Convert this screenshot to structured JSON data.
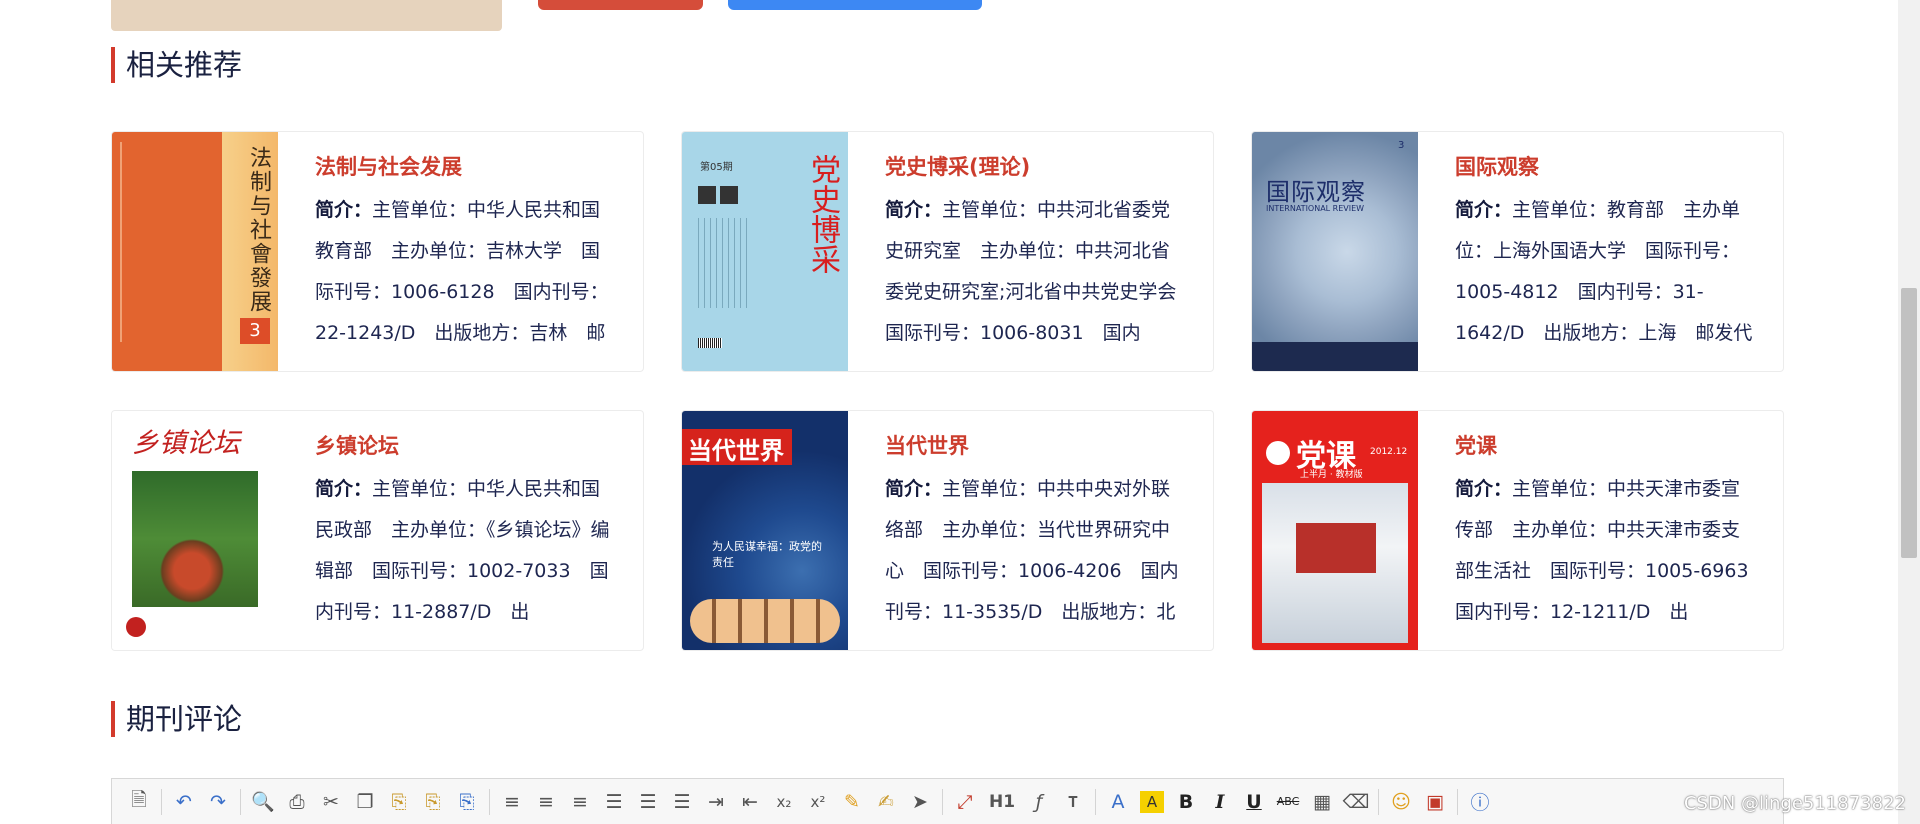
{
  "sections": {
    "related_title": "相关推荐",
    "comments_title": "期刊评论"
  },
  "cards": [
    {
      "title": "法制与社会发展",
      "desc_label": "简介：",
      "desc": "主管单位：中华人民共和国教育部　主办单位：吉林大学　国际刊号：1006-6128　国内刊号：22-1243/D　出版地方：吉林　邮",
      "cover_text": "法制与社會發展",
      "cover_num": "3"
    },
    {
      "title": "党史博采(理论)",
      "desc_label": "简介：",
      "desc": "主管单位：中共河北省委党史研究室　主办单位：中共河北省委党史研究室;河北省中共党史学会　国际刊号：1006-8031　国内",
      "cover_text": "党史博采",
      "cover_num": "第05期"
    },
    {
      "title": "国际观察",
      "desc_label": "简介：",
      "desc": "主管单位：教育部　主办单位：上海外国语大学　国际刊号：1005-4812　国内刊号：31-1642/D　出版地方：上海　邮发代",
      "cover_text": "国际观察",
      "cover_sub": "INTERNATIONAL REVIEW",
      "cover_num": "3"
    },
    {
      "title": "乡镇论坛",
      "desc_label": "简介：",
      "desc": "主管单位：中华人民共和国民政部　主办单位：《乡镇论坛》编辑部　国际刊号：1002-7033　国内刊号：11-2887/D　出",
      "cover_text": "乡镇论坛"
    },
    {
      "title": "当代世界",
      "desc_label": "简介：",
      "desc": "主管单位：中共中央对外联络部　主办单位：当代世界研究中心　国际刊号：1006-4206　国内刊号：11-3535/D　出版地方：北",
      "cover_text": "当代世界",
      "cover_sub": "为人民谋幸福：政党的责任"
    },
    {
      "title": "党课",
      "desc_label": "简介：",
      "desc": "主管单位：中共天津市委宣传部　主办单位：中共天津市委支部生活社　国际刊号：1005-6963　国内刊号：12-1211/D　出",
      "cover_text": "党课",
      "cover_sub": "上半月 · 教材版",
      "cover_num": "2012.12"
    }
  ],
  "toolbar": {
    "icons": [
      "source-icon",
      "undo-icon",
      "redo-icon",
      "preview-icon",
      "print-icon",
      "cut-icon",
      "copy-icon",
      "paste-icon",
      "paste-text-icon",
      "paste-word-icon",
      "align-left-icon",
      "align-center-icon",
      "align-right-icon",
      "justify-icon",
      "ordered-list-icon",
      "unordered-list-icon",
      "indent-icon",
      "outdent-icon",
      "subscript-icon",
      "superscript-icon",
      "clear-format-icon",
      "select-all-icon",
      "cursor-icon",
      "fullscreen-icon",
      "heading-icon",
      "font-family-icon",
      "font-size-icon",
      "font-color-icon",
      "highlight-icon",
      "bold-icon",
      "italic-icon",
      "underline-icon",
      "strikethrough-icon",
      "table-icon",
      "eraser-icon",
      "emoticon-icon",
      "image-icon",
      "help-icon"
    ],
    "heading_label": "H1",
    "bold_label": "B",
    "italic_label": "I",
    "underline_label": "U",
    "strike_label": "ABC"
  },
  "watermark": "CSDN @linge511873822"
}
